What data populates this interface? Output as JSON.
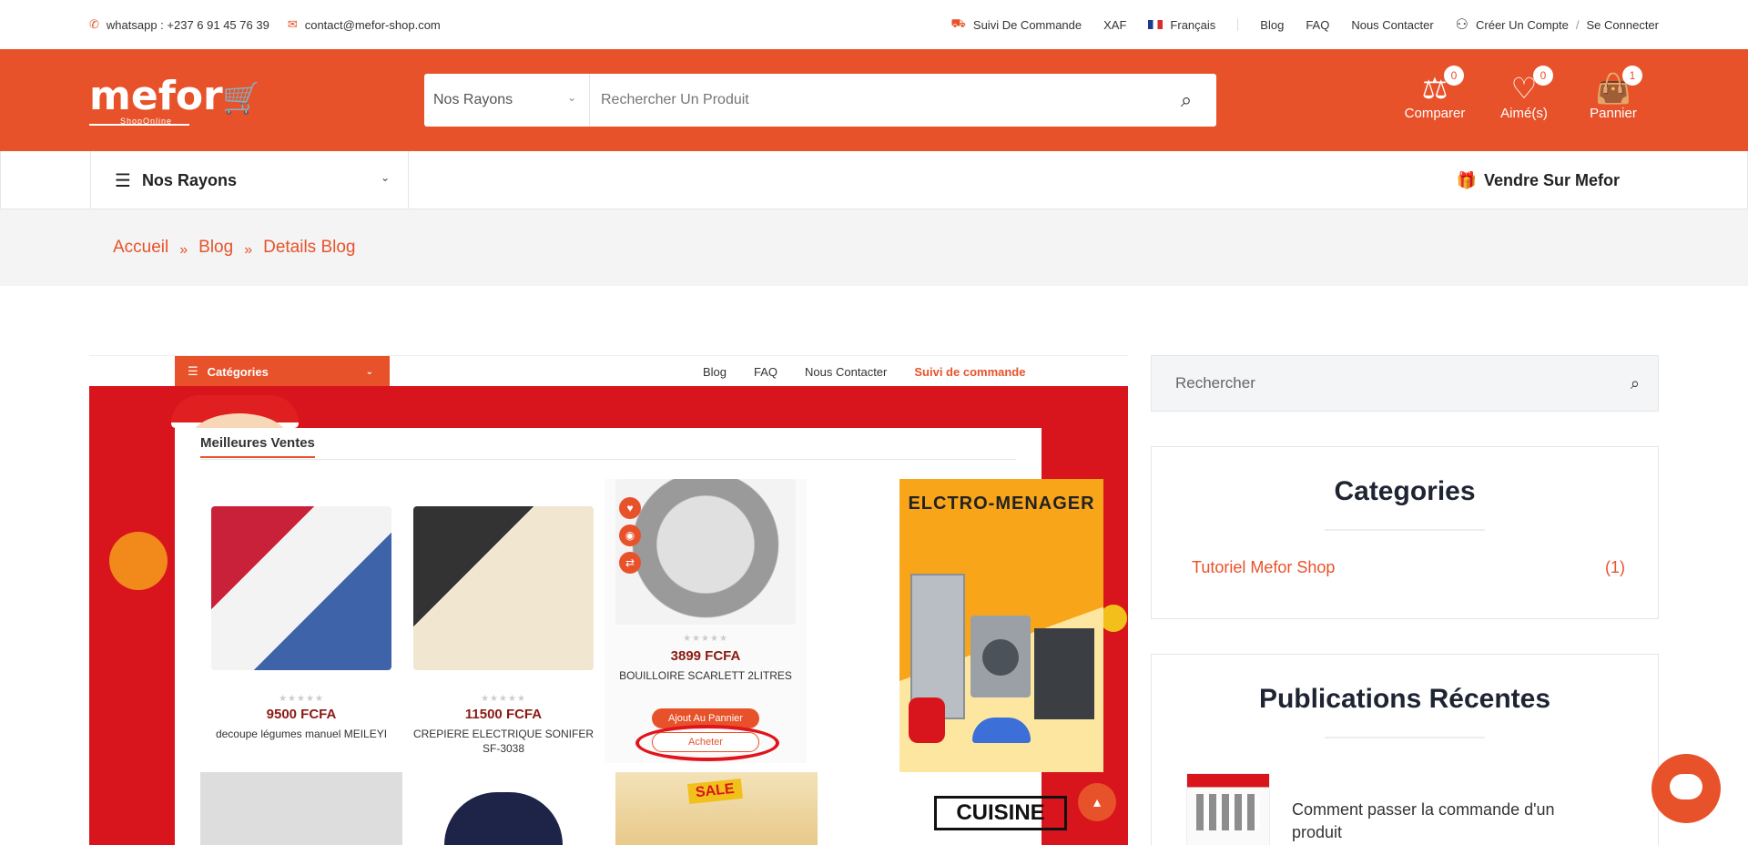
{
  "topbar": {
    "whatsapp": "whatsapp : +237 6 91 45 76 39",
    "email": "contact@mefor-shop.com",
    "suivi": "Suivi De Commande",
    "currency": "XAF",
    "language": "Français",
    "blog": "Blog",
    "faq": "FAQ",
    "contact": "Nous Contacter",
    "account": "Créer Un Compte",
    "slash": "/",
    "login": "Se Connecter"
  },
  "header": {
    "logo_word": "mefor",
    "logo_tag": "ShopOnline",
    "rayons_label": "Nos Rayons",
    "search_placeholder": "Rechercher Un Produit",
    "compare_label": "Comparer",
    "compare_count": "0",
    "liked_label": "Aimé(s)",
    "liked_count": "0",
    "cart_label": "Pannier",
    "cart_count": "1"
  },
  "nav": {
    "rayons": "Nos Rayons",
    "vendre": "Vendre Sur Mefor"
  },
  "breadcrumb": {
    "items": [
      "Accueil",
      "Blog",
      "Details Blog"
    ]
  },
  "blog_image": {
    "categories": "Catégories",
    "nav": [
      "Blog",
      "FAQ",
      "Nous Contacter",
      "Suivi de commande"
    ],
    "section_title": "Meilleures Ventes",
    "products": [
      {
        "price": "9500 FCFA",
        "name": "decoupe légumes manuel MEILEYI"
      },
      {
        "price": "11500 FCFA",
        "name": "CREPIERE ELECTRIQUE SONIFER SF-3038"
      },
      {
        "price": "3899 FCFA",
        "name": "BOUILLOIRE SCARLETT 2LITRES"
      }
    ],
    "add_to_cart": "Ajout Au Pannier",
    "buy": "Acheter",
    "banner_title": "ELCTRO-MENAGER",
    "sale": "SALE",
    "cuisine": "CUISINE",
    "stars": "★★★★★"
  },
  "sidebar": {
    "search_placeholder": "Rechercher",
    "categories_title": "Categories",
    "category_name": "Tutoriel Mefor Shop",
    "category_count": "(1)",
    "recent_title": "Publications Récentes",
    "recent_post": "Comment passer la commande d'un produit"
  },
  "colors": {
    "brand": "#e8522a",
    "price": "#8b1a14"
  },
  "icons": [
    "phone-icon",
    "mail-icon",
    "truck-icon",
    "user-icon",
    "search-icon",
    "compare-icon",
    "heart-icon",
    "bag-icon",
    "menu-icon",
    "gift-icon",
    "chevron-down-icon",
    "arrow-up-icon",
    "chat-icon"
  ]
}
